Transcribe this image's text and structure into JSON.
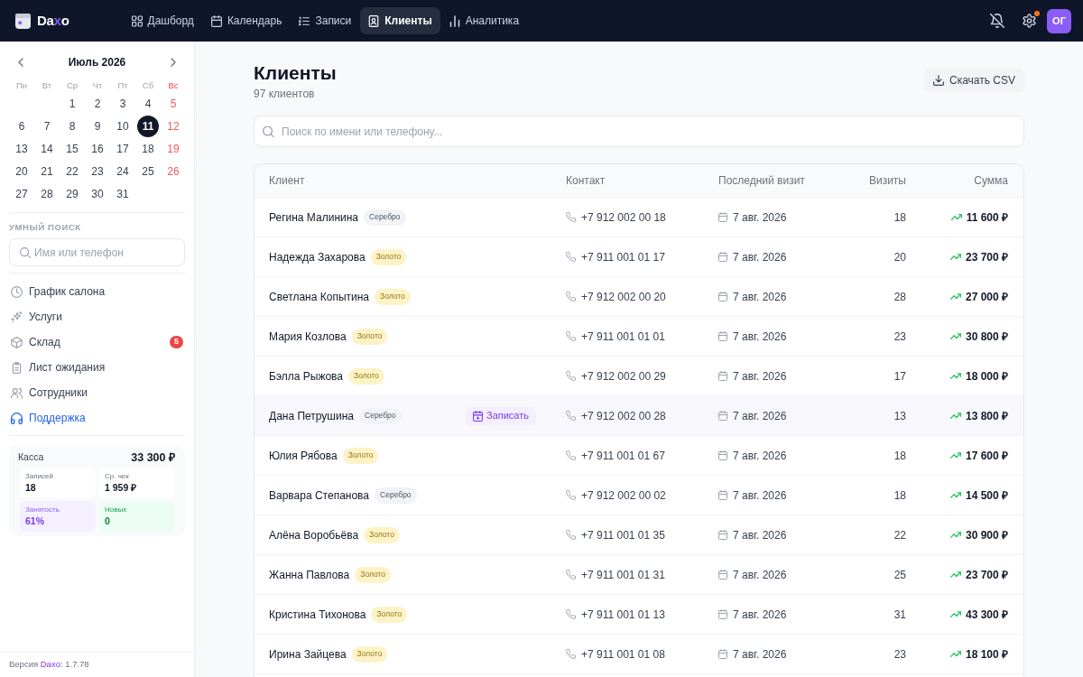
{
  "navbar": {
    "brand": [
      {
        "text": "Da",
        "accent": false
      },
      {
        "text": "x",
        "accent": true
      },
      {
        "text": "o",
        "accent": false
      }
    ],
    "tabs": [
      {
        "label": "Дашборд",
        "selected": false
      },
      {
        "label": "Календарь",
        "selected": false
      },
      {
        "label": "Записи",
        "selected": false
      },
      {
        "label": "Клиенты",
        "selected": true
      },
      {
        "label": "Аналитика",
        "selected": false
      }
    ],
    "settings_alert": true,
    "avatar": "ОГ"
  },
  "sidebar": {
    "calendar": {
      "month": "Июль 2026",
      "weekdays": [
        {
          "label": "Пн",
          "weekend": false
        },
        {
          "label": "Вт",
          "weekend": false
        },
        {
          "label": "Ср",
          "weekend": false
        },
        {
          "label": "Чт",
          "weekend": false
        },
        {
          "label": "Пт",
          "weekend": false
        },
        {
          "label": "Сб",
          "weekend": false
        },
        {
          "label": "Вс",
          "weekend": true
        }
      ],
      "weeks": [
        [
          {
            "label": "1",
            "selected": false
          },
          {
            "label": "2",
            "selected": false
          },
          {
            "label": "3",
            "selected": false
          },
          {
            "label": "4",
            "selected": false
          },
          {
            "label": "5",
            "selected": false
          }
        ],
        [
          {
            "label": "6",
            "selected": false
          },
          {
            "label": "7",
            "selected": false
          },
          {
            "label": "8",
            "selected": false
          },
          {
            "label": "9",
            "selected": false
          },
          {
            "label": "10",
            "selected": false
          },
          {
            "label": "11",
            "selected": true
          },
          {
            "label": "12",
            "selected": false
          }
        ],
        [
          {
            "label": "13",
            "selected": false
          },
          {
            "label": "14",
            "selected": false
          },
          {
            "label": "15",
            "selected": false
          },
          {
            "label": "16",
            "selected": false
          },
          {
            "label": "17",
            "selected": false
          },
          {
            "label": "18",
            "selected": false
          },
          {
            "label": "19",
            "selected": false
          }
        ],
        [
          {
            "label": "20",
            "selected": false
          },
          {
            "label": "21",
            "selected": false
          },
          {
            "label": "22",
            "selected": false
          },
          {
            "label": "23",
            "selected": false
          },
          {
            "label": "24",
            "selected": false
          },
          {
            "label": "25",
            "selected": false
          },
          {
            "label": "26",
            "selected": false
          }
        ],
        [
          {
            "label": "27",
            "selected": false
          },
          {
            "label": "28",
            "selected": false
          },
          {
            "label": "29",
            "selected": false
          },
          {
            "label": "30",
            "selected": false
          },
          {
            "label": "31",
            "selected": false
          }
        ]
      ]
    },
    "smart_search": {
      "title": "УМНЫЙ ПОИСК",
      "placeholder": "Имя или телефон"
    },
    "menu": [
      {
        "label": "График салона",
        "selected": false
      },
      {
        "label": "Услуги",
        "selected": false
      },
      {
        "label": "Склад",
        "selected": false,
        "badge": "5"
      },
      {
        "label": "Лист ожидания",
        "selected": false
      },
      {
        "label": "Сотрудники",
        "selected": false
      },
      {
        "label": "Поддержка",
        "selected": true
      }
    ],
    "cash": {
      "label": "Касса",
      "total": "33 300 ₽",
      "stats": [
        {
          "label": "Записей",
          "value": "18",
          "kind": "plain"
        },
        {
          "label": "Ср. чек",
          "value": "1 959 ₽",
          "kind": "plain"
        },
        {
          "label": "Занятость",
          "value": "61%",
          "kind": "violet"
        },
        {
          "label": "Новых",
          "value": "0",
          "kind": "mint"
        }
      ]
    },
    "version": {
      "prefix": "Версия",
      "brand": "Daxo",
      "suffix": ": 1.7.78"
    }
  },
  "main": {
    "title": "Клиенты",
    "subtitle": "97 клиентов",
    "export_button": "Скачать CSV",
    "search": {
      "placeholder": "Поиск по имени или телефону..."
    },
    "table": {
      "columns": [
        "Клиент",
        "Контакт",
        "Последний визит",
        "Визиты",
        "Сумма"
      ],
      "row_action": "Записать",
      "rows": [
        {
          "name": "Регина Малинина",
          "tier": {
            "label": "Серебро",
            "color": "#f1f3f6"
          },
          "phone": "+7 912 002 00 18",
          "last_visit": "7 авг. 2026",
          "visits": "18",
          "total": "11 600 ₽",
          "hovered": false
        },
        {
          "name": "Надежда Захарова",
          "tier": {
            "label": "Золото",
            "color": "#fef3c7"
          },
          "phone": "+7 911 001 01 17",
          "last_visit": "7 авг. 2026",
          "visits": "20",
          "total": "23 700 ₽",
          "hovered": false
        },
        {
          "name": "Светлана Копытина",
          "tier": {
            "label": "Золото",
            "color": "#fef3c7"
          },
          "phone": "+7 912 002 00 20",
          "last_visit": "7 авг. 2026",
          "visits": "28",
          "total": "27 000 ₽",
          "hovered": false
        },
        {
          "name": "Мария Козлова",
          "tier": {
            "label": "Золото",
            "color": "#fef3c7"
          },
          "phone": "+7 911 001 01 01",
          "last_visit": "7 авг. 2026",
          "visits": "23",
          "total": "30 800 ₽",
          "hovered": false
        },
        {
          "name": "Бэлла Рыжова",
          "tier": {
            "label": "Золото",
            "color": "#fef3c7"
          },
          "phone": "+7 912 002 00 29",
          "last_visit": "7 авг. 2026",
          "visits": "17",
          "total": "18 000 ₽",
          "hovered": false
        },
        {
          "name": "Дана Петрушина",
          "tier": {
            "label": "Серебро",
            "color": "#f1f3f6"
          },
          "phone": "+7 912 002 00 28",
          "last_visit": "7 авг. 2026",
          "visits": "13",
          "total": "13 800 ₽",
          "hovered": true
        },
        {
          "name": "Юлия Рябова",
          "tier": {
            "label": "Золото",
            "color": "#fef3c7"
          },
          "phone": "+7 911 001 01 67",
          "last_visit": "7 авг. 2026",
          "visits": "18",
          "total": "17 600 ₽",
          "hovered": false
        },
        {
          "name": "Варвара Степанова",
          "tier": {
            "label": "Серебро",
            "color": "#f1f3f6"
          },
          "phone": "+7 912 002 00 02",
          "last_visit": "7 авг. 2026",
          "visits": "18",
          "total": "14 500 ₽",
          "hovered": false
        },
        {
          "name": "Алёна Воробьёва",
          "tier": {
            "label": "Золото",
            "color": "#fef3c7"
          },
          "phone": "+7 911 001 01 35",
          "last_visit": "7 авг. 2026",
          "visits": "22",
          "total": "30 900 ₽",
          "hovered": false
        },
        {
          "name": "Жанна Павлова",
          "tier": {
            "label": "Золото",
            "color": "#fef3c7"
          },
          "phone": "+7 911 001 01 31",
          "last_visit": "7 авг. 2026",
          "visits": "25",
          "total": "23 700 ₽",
          "hovered": false
        },
        {
          "name": "Кристина Тихонова",
          "tier": {
            "label": "Золото",
            "color": "#fef3c7"
          },
          "phone": "+7 911 001 01 13",
          "last_visit": "7 авг. 2026",
          "visits": "31",
          "total": "43 300 ₽",
          "hovered": false
        },
        {
          "name": "Ирина Зайцева",
          "tier": {
            "label": "Золото",
            "color": "#fef3c7"
          },
          "phone": "+7 911 001 01 08",
          "last_visit": "7 авг. 2026",
          "visits": "23",
          "total": "18 100 ₽",
          "hovered": false
        }
      ]
    }
  }
}
